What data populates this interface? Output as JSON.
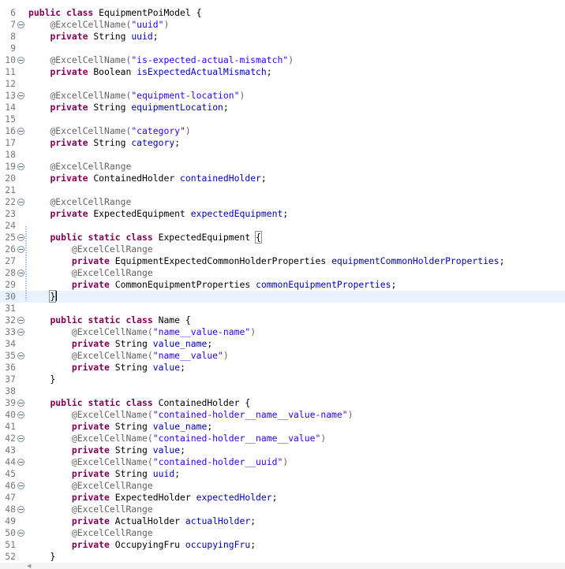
{
  "editor": {
    "current_line": 30,
    "lines": [
      {
        "n": "6",
        "fold": false,
        "t": [
          [
            "kw",
            "public class "
          ],
          [
            "pl",
            "EquipmentPoiModel {"
          ]
        ]
      },
      {
        "n": "7",
        "fold": true,
        "t": [
          [
            "pl",
            "    "
          ],
          [
            "ann",
            "@ExcelCellName("
          ],
          [
            "str",
            "\"uuid\""
          ],
          [
            "ann",
            ")"
          ]
        ]
      },
      {
        "n": "8",
        "fold": false,
        "t": [
          [
            "pl",
            "    "
          ],
          [
            "kw",
            "private "
          ],
          [
            "pl",
            "String "
          ],
          [
            "fld",
            "uuid"
          ],
          [
            "pl",
            ";"
          ]
        ]
      },
      {
        "n": "9",
        "fold": false,
        "t": []
      },
      {
        "n": "10",
        "fold": true,
        "t": [
          [
            "pl",
            "    "
          ],
          [
            "ann",
            "@ExcelCellName("
          ],
          [
            "str",
            "\"is-expected-actual-mismatch\""
          ],
          [
            "ann",
            ")"
          ]
        ]
      },
      {
        "n": "11",
        "fold": false,
        "t": [
          [
            "pl",
            "    "
          ],
          [
            "kw",
            "private "
          ],
          [
            "pl",
            "Boolean "
          ],
          [
            "fld",
            "isExpectedActualMismatch"
          ],
          [
            "pl",
            ";"
          ]
        ]
      },
      {
        "n": "12",
        "fold": false,
        "t": []
      },
      {
        "n": "13",
        "fold": true,
        "t": [
          [
            "pl",
            "    "
          ],
          [
            "ann",
            "@ExcelCellName("
          ],
          [
            "str",
            "\"equipment-location\""
          ],
          [
            "ann",
            ")"
          ]
        ]
      },
      {
        "n": "14",
        "fold": false,
        "t": [
          [
            "pl",
            "    "
          ],
          [
            "kw",
            "private "
          ],
          [
            "pl",
            "String "
          ],
          [
            "fld",
            "equipmentLocation"
          ],
          [
            "pl",
            ";"
          ]
        ]
      },
      {
        "n": "15",
        "fold": false,
        "t": []
      },
      {
        "n": "16",
        "fold": true,
        "t": [
          [
            "pl",
            "    "
          ],
          [
            "ann",
            "@ExcelCellName("
          ],
          [
            "str",
            "\"category\""
          ],
          [
            "ann",
            ")"
          ]
        ]
      },
      {
        "n": "17",
        "fold": false,
        "t": [
          [
            "pl",
            "    "
          ],
          [
            "kw",
            "private "
          ],
          [
            "pl",
            "String "
          ],
          [
            "fld",
            "category"
          ],
          [
            "pl",
            ";"
          ]
        ]
      },
      {
        "n": "18",
        "fold": false,
        "t": []
      },
      {
        "n": "19",
        "fold": true,
        "t": [
          [
            "pl",
            "    "
          ],
          [
            "ann",
            "@ExcelCellRange"
          ]
        ]
      },
      {
        "n": "20",
        "fold": false,
        "t": [
          [
            "pl",
            "    "
          ],
          [
            "kw",
            "private "
          ],
          [
            "pl",
            "ContainedHolder "
          ],
          [
            "fld",
            "containedHolder"
          ],
          [
            "pl",
            ";"
          ]
        ]
      },
      {
        "n": "21",
        "fold": false,
        "t": []
      },
      {
        "n": "22",
        "fold": true,
        "t": [
          [
            "pl",
            "    "
          ],
          [
            "ann",
            "@ExcelCellRange"
          ]
        ]
      },
      {
        "n": "23",
        "fold": false,
        "t": [
          [
            "pl",
            "    "
          ],
          [
            "kw",
            "private "
          ],
          [
            "pl",
            "ExpectedEquipment "
          ],
          [
            "fld",
            "expectedEquipment"
          ],
          [
            "pl",
            ";"
          ]
        ]
      },
      {
        "n": "24",
        "fold": false,
        "t": []
      },
      {
        "n": "25",
        "fold": true,
        "t": [
          [
            "pl",
            "    "
          ],
          [
            "kw",
            "public static class "
          ],
          [
            "pl",
            "ExpectedEquipment "
          ],
          [
            "br",
            "{"
          ]
        ]
      },
      {
        "n": "26",
        "fold": true,
        "t": [
          [
            "pl",
            "        "
          ],
          [
            "ann",
            "@ExcelCellRange"
          ]
        ]
      },
      {
        "n": "27",
        "fold": false,
        "t": [
          [
            "pl",
            "        "
          ],
          [
            "kw",
            "private "
          ],
          [
            "pl",
            "EquipmentExpectedCommonHolderProperties "
          ],
          [
            "fld",
            "equipmentCommonHolderProperties"
          ],
          [
            "pl",
            ";"
          ]
        ]
      },
      {
        "n": "28",
        "fold": true,
        "t": [
          [
            "pl",
            "        "
          ],
          [
            "ann",
            "@ExcelCellRange"
          ]
        ]
      },
      {
        "n": "29",
        "fold": false,
        "t": [
          [
            "pl",
            "        "
          ],
          [
            "kw",
            "private "
          ],
          [
            "pl",
            "CommonEquipmentProperties "
          ],
          [
            "fld",
            "commonEquipmentProperties"
          ],
          [
            "pl",
            ";"
          ]
        ]
      },
      {
        "n": "30",
        "fold": false,
        "t": [
          [
            "pl",
            "    "
          ],
          [
            "br",
            "}"
          ],
          [
            "caret",
            ""
          ]
        ]
      },
      {
        "n": "31",
        "fold": false,
        "t": []
      },
      {
        "n": "32",
        "fold": true,
        "t": [
          [
            "pl",
            "    "
          ],
          [
            "kw",
            "public static class "
          ],
          [
            "pl",
            "Name {"
          ]
        ]
      },
      {
        "n": "33",
        "fold": true,
        "t": [
          [
            "pl",
            "        "
          ],
          [
            "ann",
            "@ExcelCellName("
          ],
          [
            "str",
            "\"name__value-name\""
          ],
          [
            "ann",
            ")"
          ]
        ]
      },
      {
        "n": "34",
        "fold": false,
        "t": [
          [
            "pl",
            "        "
          ],
          [
            "kw",
            "private "
          ],
          [
            "pl",
            "String "
          ],
          [
            "fld",
            "value_name"
          ],
          [
            "pl",
            ";"
          ]
        ]
      },
      {
        "n": "35",
        "fold": true,
        "t": [
          [
            "pl",
            "        "
          ],
          [
            "ann",
            "@ExcelCellName("
          ],
          [
            "str",
            "\"name__value\""
          ],
          [
            "ann",
            ")"
          ]
        ]
      },
      {
        "n": "36",
        "fold": false,
        "t": [
          [
            "pl",
            "        "
          ],
          [
            "kw",
            "private "
          ],
          [
            "pl",
            "String "
          ],
          [
            "fld",
            "value"
          ],
          [
            "pl",
            ";"
          ]
        ]
      },
      {
        "n": "37",
        "fold": false,
        "t": [
          [
            "pl",
            "    }"
          ]
        ]
      },
      {
        "n": "38",
        "fold": false,
        "t": []
      },
      {
        "n": "39",
        "fold": true,
        "t": [
          [
            "pl",
            "    "
          ],
          [
            "kw",
            "public static class "
          ],
          [
            "pl",
            "ContainedHolder {"
          ]
        ]
      },
      {
        "n": "40",
        "fold": true,
        "t": [
          [
            "pl",
            "        "
          ],
          [
            "ann",
            "@ExcelCellName("
          ],
          [
            "str",
            "\"contained-holder__name__value-name\""
          ],
          [
            "ann",
            ")"
          ]
        ]
      },
      {
        "n": "41",
        "fold": false,
        "t": [
          [
            "pl",
            "        "
          ],
          [
            "kw",
            "private "
          ],
          [
            "pl",
            "String "
          ],
          [
            "fld",
            "value_name"
          ],
          [
            "pl",
            ";"
          ]
        ]
      },
      {
        "n": "42",
        "fold": true,
        "t": [
          [
            "pl",
            "        "
          ],
          [
            "ann",
            "@ExcelCellName("
          ],
          [
            "str",
            "\"contained-holder__name__value\""
          ],
          [
            "ann",
            ")"
          ]
        ]
      },
      {
        "n": "43",
        "fold": false,
        "t": [
          [
            "pl",
            "        "
          ],
          [
            "kw",
            "private "
          ],
          [
            "pl",
            "String "
          ],
          [
            "fld",
            "value"
          ],
          [
            "pl",
            ";"
          ]
        ]
      },
      {
        "n": "44",
        "fold": true,
        "t": [
          [
            "pl",
            "        "
          ],
          [
            "ann",
            "@ExcelCellName("
          ],
          [
            "str",
            "\"contained-holder__uuid\""
          ],
          [
            "ann",
            ")"
          ]
        ]
      },
      {
        "n": "45",
        "fold": false,
        "t": [
          [
            "pl",
            "        "
          ],
          [
            "kw",
            "private "
          ],
          [
            "pl",
            "String "
          ],
          [
            "fld",
            "uuid"
          ],
          [
            "pl",
            ";"
          ]
        ]
      },
      {
        "n": "46",
        "fold": true,
        "t": [
          [
            "pl",
            "        "
          ],
          [
            "ann",
            "@ExcelCellRange"
          ]
        ]
      },
      {
        "n": "47",
        "fold": false,
        "t": [
          [
            "pl",
            "        "
          ],
          [
            "kw",
            "private "
          ],
          [
            "pl",
            "ExpectedHolder "
          ],
          [
            "fld",
            "expectedHolder"
          ],
          [
            "pl",
            ";"
          ]
        ]
      },
      {
        "n": "48",
        "fold": true,
        "t": [
          [
            "pl",
            "        "
          ],
          [
            "ann",
            "@ExcelCellRange"
          ]
        ]
      },
      {
        "n": "49",
        "fold": false,
        "t": [
          [
            "pl",
            "        "
          ],
          [
            "kw",
            "private "
          ],
          [
            "pl",
            "ActualHolder "
          ],
          [
            "fld",
            "actualHolder"
          ],
          [
            "pl",
            ";"
          ]
        ]
      },
      {
        "n": "50",
        "fold": true,
        "t": [
          [
            "pl",
            "        "
          ],
          [
            "ann",
            "@ExcelCellRange"
          ]
        ]
      },
      {
        "n": "51",
        "fold": false,
        "t": [
          [
            "pl",
            "        "
          ],
          [
            "kw",
            "private "
          ],
          [
            "pl",
            "OccupyingFru "
          ],
          [
            "fld",
            "occupyingFru"
          ],
          [
            "pl",
            ";"
          ]
        ]
      },
      {
        "n": "52",
        "fold": false,
        "t": [
          [
            "pl",
            "    }"
          ]
        ]
      }
    ]
  },
  "colors": {
    "keyword": "#7f0055",
    "annotation": "#646464",
    "string": "#2a00ff",
    "field": "#0000c0",
    "current_line_bg": "#e8f2fe",
    "line_number": "#787878"
  },
  "icons": {
    "fold": "collapse-circle-minus-icon",
    "scroll_left": "left-arrow-icon"
  }
}
